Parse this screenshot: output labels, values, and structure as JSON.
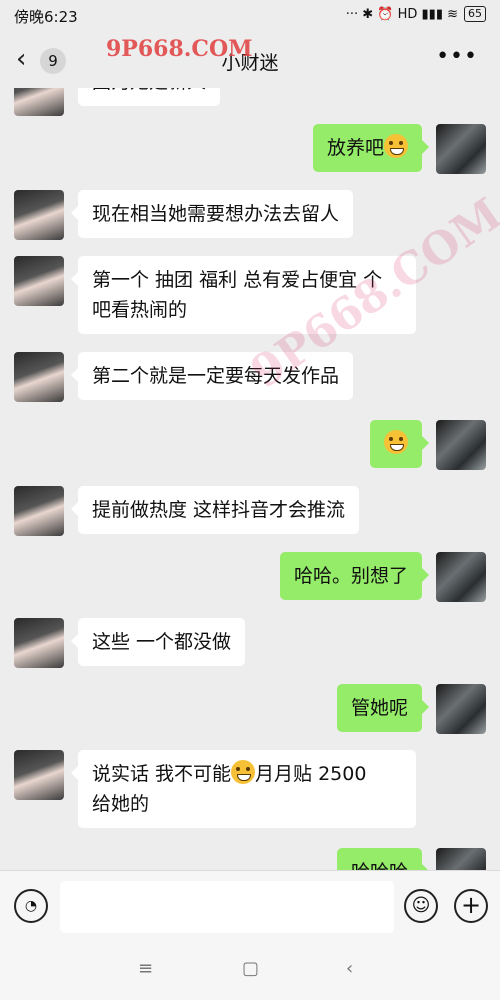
{
  "status": {
    "time": "傍晚6:23",
    "icons": "··· ✱ ⏰ HD ▮▮▮ ≋",
    "battery": "65"
  },
  "header": {
    "unread_count": "9",
    "title": "小财迷"
  },
  "watermark": {
    "top": "9P668.COM"
  },
  "messages": [
    {
      "side": "in",
      "text": "因为她是新人"
    },
    {
      "side": "out",
      "text": "放养吧"
    },
    {
      "side": "in",
      "text": "现在相当她需要想办法去留人"
    },
    {
      "side": "in",
      "text": "第一个 抽团 福利 总有爱占便宜 个\n吧看热闹的"
    },
    {
      "side": "in",
      "text": "第二个就是一定要每天发作品"
    },
    {
      "side": "out",
      "text": ""
    },
    {
      "side": "in",
      "text": "提前做热度 这样抖音才会推流"
    },
    {
      "side": "out",
      "text": "哈哈。别想了"
    },
    {
      "side": "in",
      "text": "这些 一个都没做"
    },
    {
      "side": "out",
      "text": "管她呢"
    },
    {
      "side": "in",
      "text_a": "说实话 我不可能",
      "text_b": "月月贴 2500",
      "text_c": "给她的"
    },
    {
      "side": "out",
      "text": "哈哈哈"
    }
  ],
  "icons": {
    "back": "chevron-left-icon",
    "more": "more-dots-icon",
    "voice": "voice-icon",
    "emoji": "emoji-icon",
    "plus": "plus-icon",
    "nav_menu": "menu-icon",
    "nav_home": "home-icon",
    "nav_back": "back-icon"
  },
  "colors": {
    "outgoing_bubble": "#95ec69",
    "incoming_bubble": "#ffffff",
    "background": "#ededed"
  }
}
